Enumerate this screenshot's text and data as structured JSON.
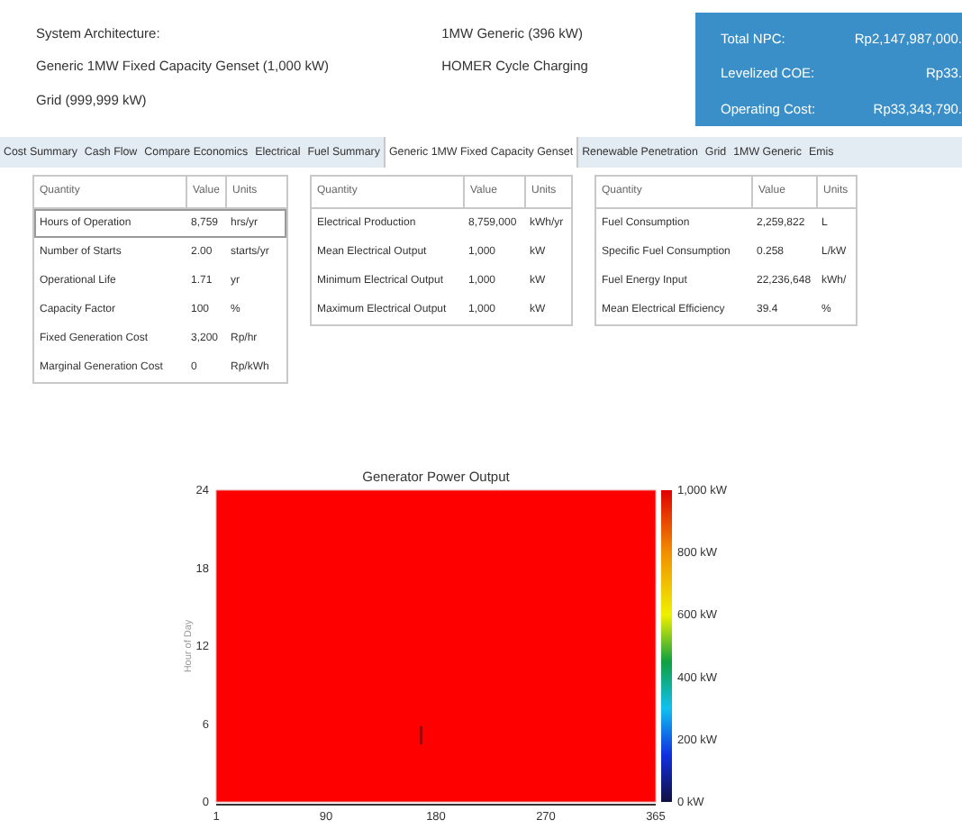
{
  "architecture": {
    "rows": [
      {
        "label": "System Architecture:",
        "value": "1MW Generic (396 kW)"
      },
      {
        "label": "Generic 1MW Fixed Capacity Genset (1,000 kW)",
        "value": "HOMER Cycle Charging"
      },
      {
        "label": "Grid (999,999 kW)",
        "value": ""
      }
    ]
  },
  "summary": [
    {
      "label": "Total NPC:",
      "value": "Rp2,147,987,000."
    },
    {
      "label": "Levelized COE:",
      "value": "Rp33."
    },
    {
      "label": "Operating Cost:",
      "value": "Rp33,343,790."
    }
  ],
  "tabs": [
    {
      "label": "Cost Summary",
      "selected": false
    },
    {
      "label": "Cash Flow",
      "selected": false
    },
    {
      "label": "Compare Economics",
      "selected": false
    },
    {
      "label": "Electrical",
      "selected": false
    },
    {
      "label": "Fuel Summary",
      "selected": false
    },
    {
      "label": "Generic 1MW Fixed Capacity Genset",
      "selected": true
    },
    {
      "label": "Renewable Penetration",
      "selected": false
    },
    {
      "label": "Grid",
      "selected": false
    },
    {
      "label": "1MW Generic",
      "selected": false
    },
    {
      "label": "Emis",
      "selected": false
    }
  ],
  "tables": [
    {
      "columns": [
        "Quantity",
        "Value",
        "Units"
      ],
      "rows": [
        {
          "cells": [
            "Hours of Operation",
            "8,759",
            "hrs/yr"
          ],
          "selected": true
        },
        {
          "cells": [
            "Number of Starts",
            "2.00",
            "starts/yr"
          ],
          "selected": false
        },
        {
          "cells": [
            "Operational Life",
            "1.71",
            "yr"
          ],
          "selected": false
        },
        {
          "cells": [
            "Capacity Factor",
            "100",
            "%"
          ],
          "selected": false
        },
        {
          "cells": [
            "Fixed Generation Cost",
            "3,200",
            "Rp/hr"
          ],
          "selected": false
        },
        {
          "cells": [
            "Marginal Generation Cost",
            "0",
            "Rp/kWh"
          ],
          "selected": false
        }
      ]
    },
    {
      "columns": [
        "Quantity",
        "Value",
        "Units"
      ],
      "rows": [
        {
          "cells": [
            "Electrical Production",
            "8,759,000",
            "kWh/yr"
          ],
          "selected": false
        },
        {
          "cells": [
            "Mean Electrical Output",
            "1,000",
            "kW"
          ],
          "selected": false
        },
        {
          "cells": [
            "Minimum Electrical Output",
            "1,000",
            "kW"
          ],
          "selected": false
        },
        {
          "cells": [
            "Maximum Electrical Output",
            "1,000",
            "kW"
          ],
          "selected": false
        }
      ]
    },
    {
      "columns": [
        "Quantity",
        "Value",
        "Units"
      ],
      "rows": [
        {
          "cells": [
            "Fuel Consumption",
            "2,259,822",
            "L"
          ],
          "selected": false
        },
        {
          "cells": [
            "Specific Fuel Consumption",
            "0.258",
            "L/kW"
          ],
          "selected": false
        },
        {
          "cells": [
            "Fuel Energy Input",
            "22,236,648",
            "kWh/"
          ],
          "selected": false
        },
        {
          "cells": [
            "Mean Electrical Efficiency",
            "39.4",
            "%"
          ],
          "selected": false
        }
      ]
    }
  ],
  "plot": {
    "title": "Generator Power Output",
    "ylabel": "Hour of Day",
    "yticks": [
      "24",
      "18",
      "12",
      "6",
      "0"
    ],
    "xticks": [
      "1",
      "90",
      "180",
      "270",
      "365"
    ],
    "colorbar_ticks": [
      "1,000 kW",
      "800 kW",
      "600 kW",
      "400 kW",
      "200 kW",
      "0 kW"
    ]
  }
}
